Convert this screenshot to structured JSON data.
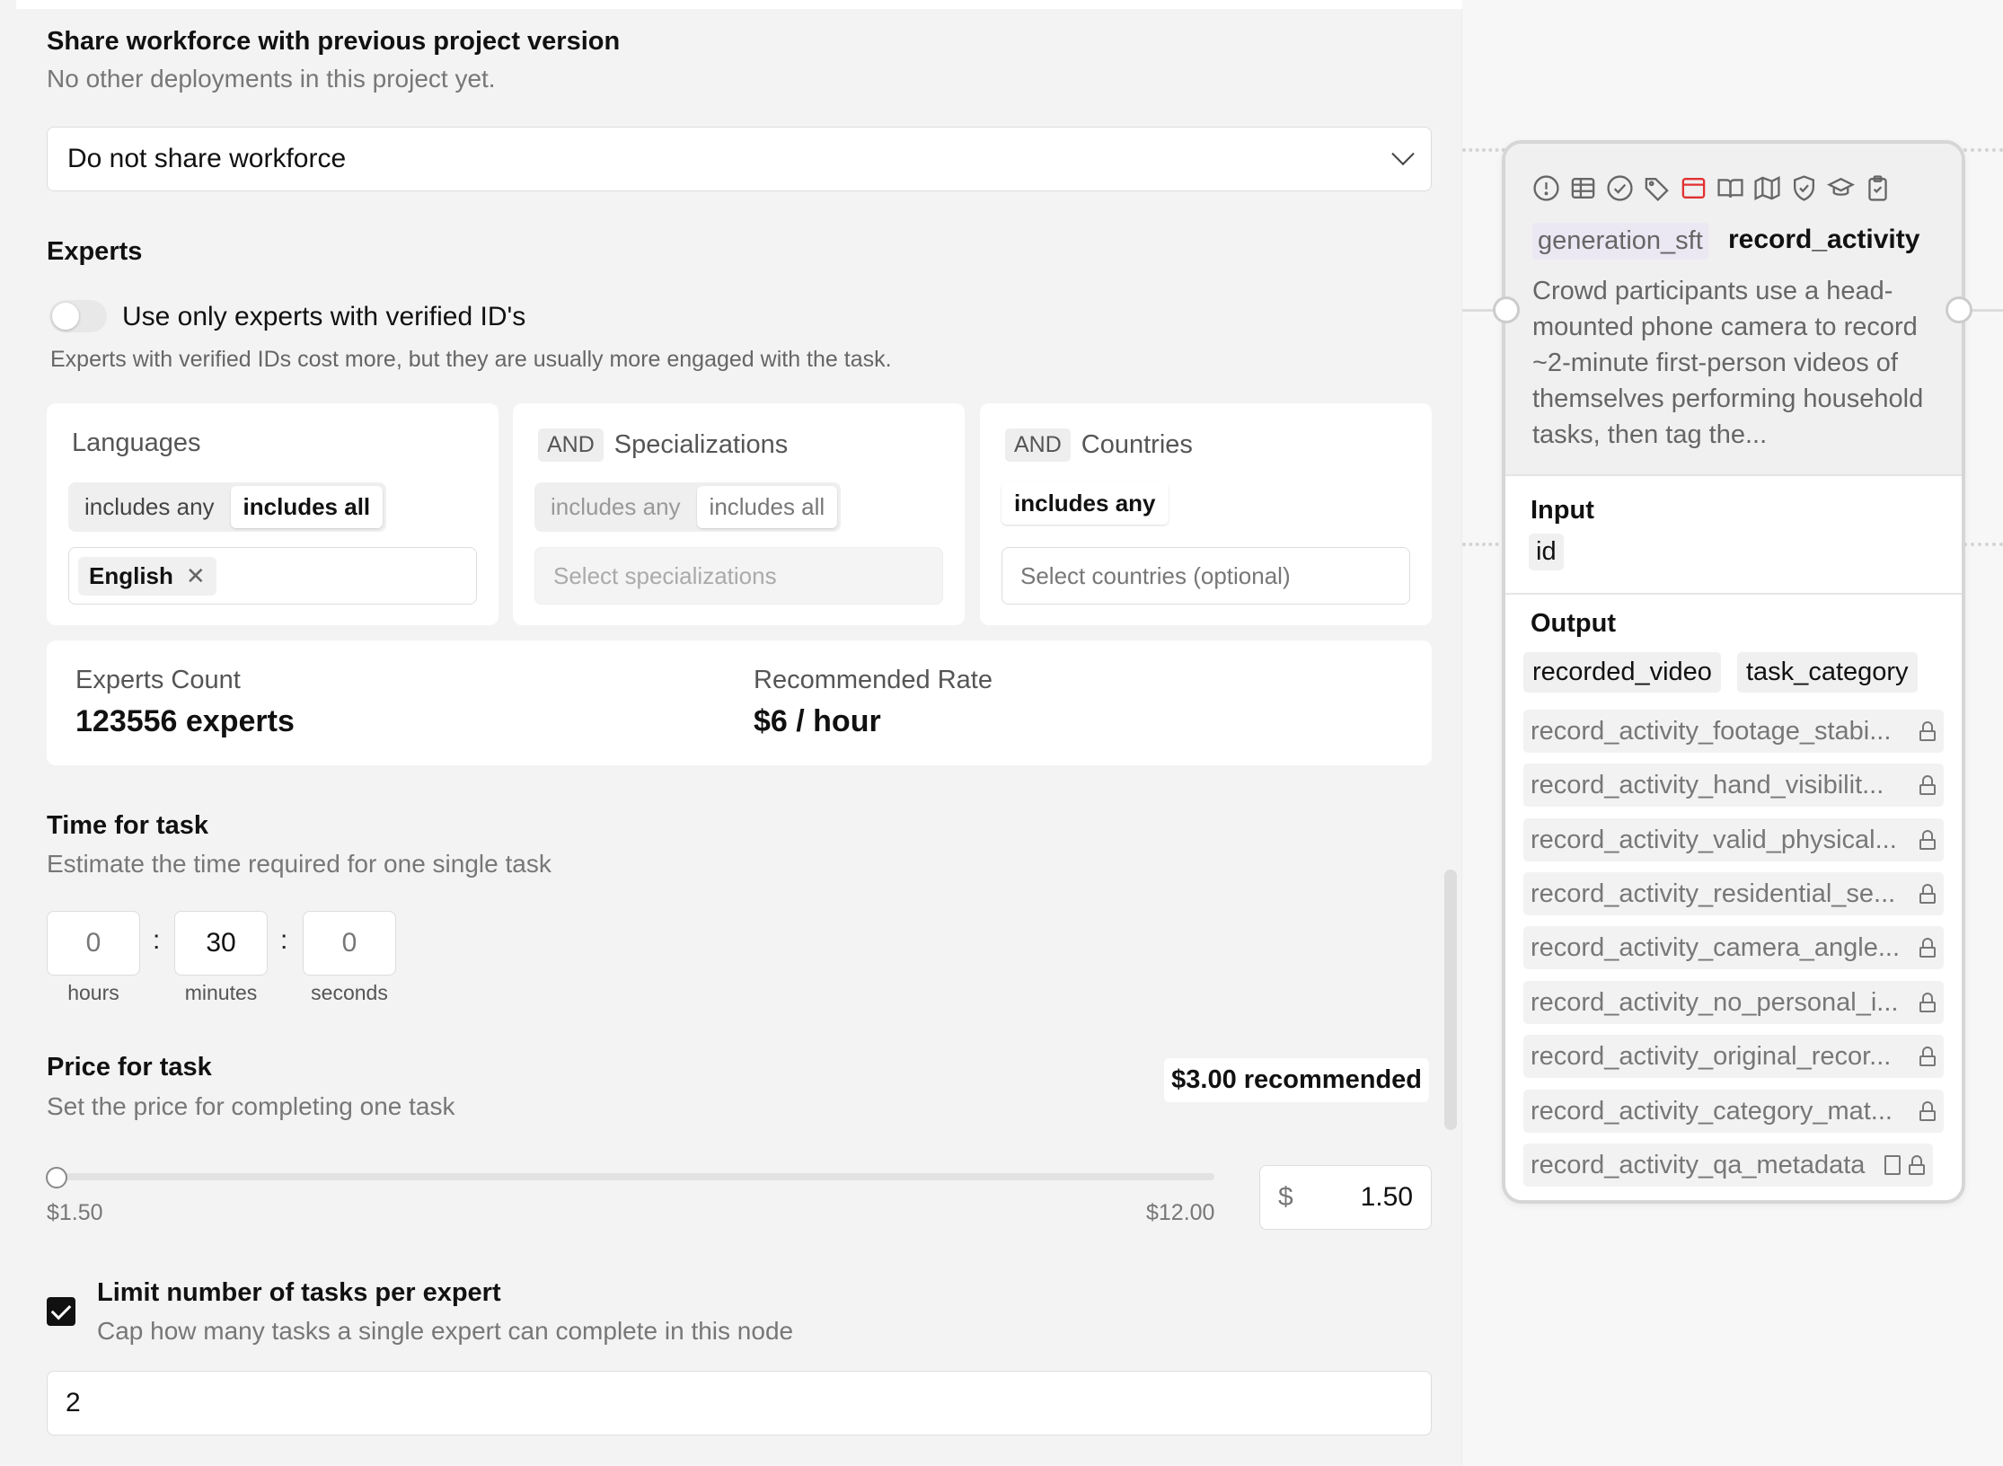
{
  "workforce": {
    "title": "Share workforce with previous project version",
    "subtitle": "No other deployments in this project yet.",
    "select_value": "Do not share workforce"
  },
  "experts": {
    "title": "Experts",
    "toggle_label": "Use only experts with verified ID's",
    "toggle_on": false,
    "note": "Experts with verified IDs cost more, but they are usually more engaged with the task."
  },
  "filters": {
    "languages": {
      "title": "Languages",
      "seg_any": "includes any",
      "seg_all": "includes all",
      "active": "includes all",
      "chips": [
        "English"
      ]
    },
    "specializations": {
      "and": "AND",
      "title": "Specializations",
      "seg_any": "includes any",
      "seg_all": "includes all",
      "placeholder": "Select specializations"
    },
    "countries": {
      "and": "AND",
      "title": "Countries",
      "seg_any": "includes any",
      "placeholder": "Select countries (optional)"
    }
  },
  "stats": {
    "count_label": "Experts Count",
    "count_value": "123556 experts",
    "rate_label": "Recommended Rate",
    "rate_value": "$6 / hour"
  },
  "time": {
    "title": "Time for task",
    "subtitle": "Estimate the time required for one single task",
    "hours": "0",
    "minutes": "30",
    "seconds": "0",
    "hours_label": "hours",
    "minutes_label": "minutes",
    "seconds_label": "seconds"
  },
  "price": {
    "title": "Price for task",
    "subtitle": "Set the price for completing one task",
    "recommended": "$3.00 recommended",
    "min_label": "$1.50",
    "max_label": "$12.00",
    "currency": "$",
    "value": "1.50"
  },
  "limit": {
    "checked": true,
    "title": "Limit number of tasks per expert",
    "subtitle": "Cap how many tasks a single expert can complete in this node",
    "value": "2"
  },
  "node": {
    "icons": [
      "alert-circle-icon",
      "table-icon",
      "check-circle-icon",
      "tag-icon",
      "browser-window-icon",
      "book-open-icon",
      "map-icon",
      "shield-check-icon",
      "graduation-cap-icon",
      "clipboard-check-icon"
    ],
    "accent_color": "#e03131",
    "tag": "generation_sft",
    "name": "record_activity",
    "description": "Crowd participants use a head-mounted phone camera to record ~2-minute first-person videos of themselves performing household tasks, then tag the...",
    "input_title": "Input",
    "inputs": [
      "id"
    ],
    "output_title": "Output",
    "outputs": [
      "recorded_video",
      "task_category"
    ],
    "locked_outputs": [
      "record_activity_footage_stabi...",
      "record_activity_hand_visibilit...",
      "record_activity_valid_physical...",
      "record_activity_residential_se...",
      "record_activity_camera_angle...",
      "record_activity_no_personal_i...",
      "record_activity_original_recor...",
      "record_activity_category_mat...",
      "record_activity_qa_metadata"
    ]
  }
}
